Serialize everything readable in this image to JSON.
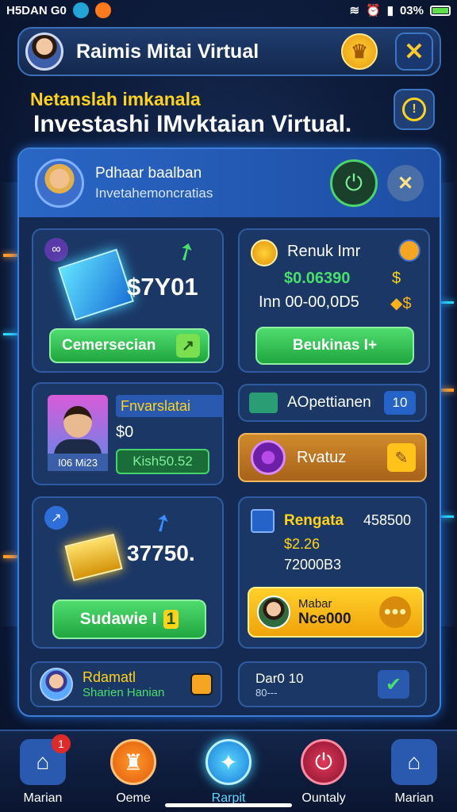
{
  "statusbar": {
    "left_text": "H5DAN  G0",
    "right_text": "03%"
  },
  "header": {
    "title": "Raimis Mitai Virtual"
  },
  "subtitle": {
    "line1": "Netanslah imkanala",
    "line2": "Investashi IMvktaian Virtual."
  },
  "notice": {
    "title": "Pdhaar baalban",
    "subtitle": "Invetahemoncratias"
  },
  "card_crypto": {
    "value": "$7Y01",
    "button_label": "Cemersecian"
  },
  "card_bonus": {
    "title": "Renuk Imr",
    "value1": "$0.06390",
    "value2": "Inn 00-00,0D5",
    "button_label": "Beukinas I+"
  },
  "card_profile": {
    "title": "Fnvarslatai",
    "value": "$0",
    "badge": "I06 Mi23",
    "stat": "Kish50.52"
  },
  "card_options": {
    "label": "AOpettianen",
    "count": "10"
  },
  "card_ravatuz": {
    "label": "Rvatuz"
  },
  "card_gold": {
    "value": "37750.",
    "button_label": "Sudawie I"
  },
  "card_rengata": {
    "title": "Rengata",
    "number": "458500",
    "value1": "$2.26",
    "value2": "72000B3"
  },
  "card_mabar": {
    "title": "Mabar",
    "value": "Nce000"
  },
  "card_bottom_left": {
    "title": "Rdamatl",
    "subtitle": "Sharien Hanian"
  },
  "card_bottom_right": {
    "title": "Dar0 10",
    "subtitle": "80---"
  },
  "nav": [
    {
      "label": "Marian",
      "badge": "1"
    },
    {
      "label": "Oeme"
    },
    {
      "label": "Rarpit"
    },
    {
      "label": "Ountaly"
    },
    {
      "label": "Marian"
    }
  ],
  "colors": {
    "accent_yellow": "#ffd31a",
    "accent_green": "#2ecf55",
    "panel_blue": "#142a52",
    "orange": "#ff8a1c"
  }
}
